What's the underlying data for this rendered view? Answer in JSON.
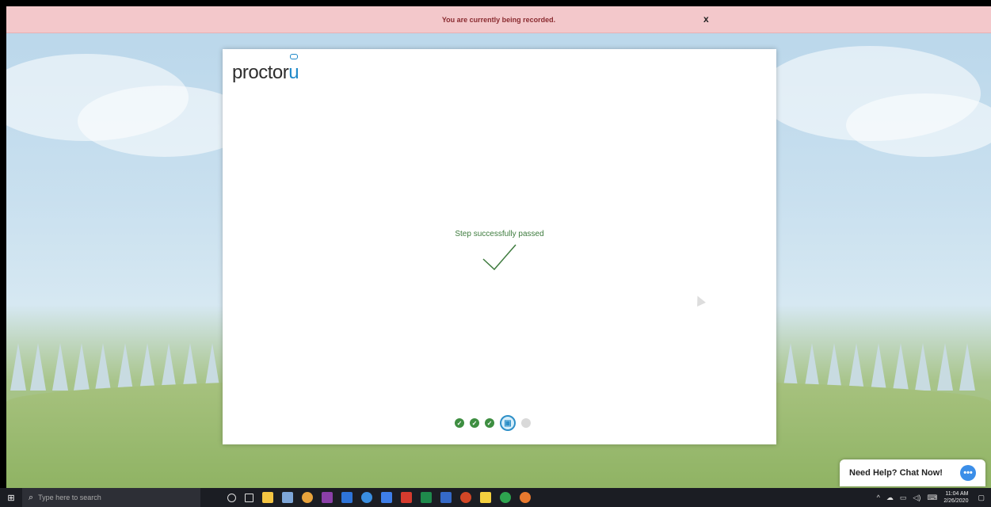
{
  "banner": {
    "message": "You are currently being recorded.",
    "close_label": "x"
  },
  "modal": {
    "logo_text": "proctor",
    "logo_u": "u",
    "status": "Step successfully passed",
    "steps": [
      {
        "state": "done",
        "icon": "checkmark-icon"
      },
      {
        "state": "done",
        "icon": "checkmark-icon"
      },
      {
        "state": "done",
        "icon": "checkmark-icon"
      },
      {
        "state": "current",
        "icon": "id-card-icon"
      },
      {
        "state": "pending",
        "icon": "dot-icon"
      }
    ]
  },
  "chat": {
    "label": "Need Help? Chat Now!"
  },
  "taskbar": {
    "search_placeholder": "Type here to search",
    "time": "11:04 AM",
    "date": "2/26/2020",
    "apps": [
      {
        "name": "cortana-icon",
        "color": "#1b1d23"
      },
      {
        "name": "task-view-icon",
        "color": "#1b1d23"
      },
      {
        "name": "file-explorer-icon",
        "color": "#f4c542"
      },
      {
        "name": "paint-icon",
        "color": "#7ea6d8"
      },
      {
        "name": "chrome-icon",
        "color": "#e8a33c"
      },
      {
        "name": "onenote-icon",
        "color": "#8b3fa8"
      },
      {
        "name": "app-blue-icon",
        "color": "#2e74d8"
      },
      {
        "name": "app-circle-icon",
        "color": "#3a8ee0"
      },
      {
        "name": "todo-icon",
        "color": "#3e7ee8"
      },
      {
        "name": "acrobat-icon",
        "color": "#d63b2e"
      },
      {
        "name": "excel-icon",
        "color": "#1f8a4c"
      },
      {
        "name": "word-icon",
        "color": "#3569c7"
      },
      {
        "name": "powerpoint-icon",
        "color": "#d24726"
      },
      {
        "name": "sticky-notes-icon",
        "color": "#f4d03f"
      },
      {
        "name": "hangouts-icon",
        "color": "#2ea44f"
      },
      {
        "name": "app-orange-icon",
        "color": "#e8792e"
      }
    ]
  },
  "colors": {
    "banner_bg": "#f3c8cb",
    "success_green": "#3e8e41",
    "accent_blue": "#2d8fc7"
  }
}
